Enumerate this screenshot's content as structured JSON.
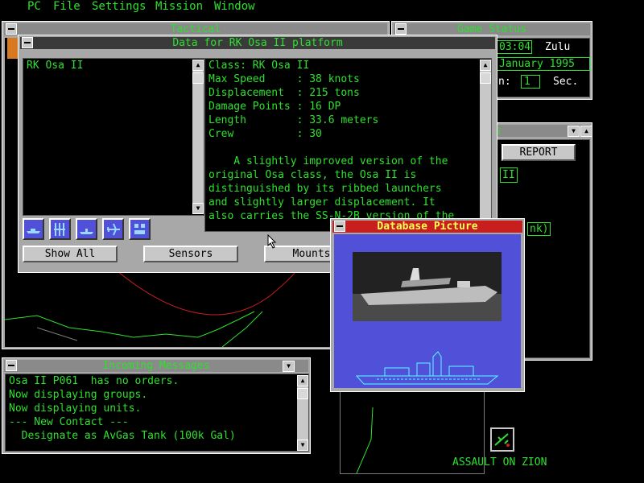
{
  "menu": [
    "PC",
    "File",
    "Settings",
    "Mission",
    "Window"
  ],
  "tactical": {
    "title": "Tactical"
  },
  "game_status": {
    "title": "Game Status",
    "time": "03:04",
    "zone": "Zulu",
    "date": "January 1995",
    "compression_label": "n:",
    "compression_value": "1",
    "unit": "Sec."
  },
  "unit_status": {
    "title": "tus",
    "report_button": "REPORT",
    "line1": "II",
    "line2": "nk)"
  },
  "platform_data": {
    "title": "Data for RK Osa II platform",
    "list_items": [
      "RK Osa II"
    ],
    "details": [
      "Class: RK Osa II",
      "Max Speed     : 38 knots",
      "Displacement  : 215 tons",
      "Damage Points : 16 DP",
      "Length        : 33.6 meters",
      "Crew          : 30"
    ],
    "description": [
      "    A slightly improved version of the",
      "original Osa class, the Osa II is",
      "distinguished by its ribbed launchers",
      "and slightly larger displacement. It",
      "also carries the SS-N-2B version of the"
    ],
    "buttons": {
      "show_all": "Show All",
      "sensors": "Sensors",
      "mounts": "Mounts"
    },
    "icon_buttons": [
      "surface-ship-icon",
      "weapons-icon",
      "submarine-icon",
      "aircraft-icon",
      "facility-icon"
    ]
  },
  "database_picture": {
    "title": "Database Picture"
  },
  "messages": {
    "title": "Incoming Messages",
    "lines": [
      "Osa II P061  has no orders.",
      "Now displaying groups.",
      "Now displaying units.",
      "--- New Contact ---",
      "  Designate as AvGas Tank (100k Gal)"
    ]
  },
  "mission_title": "ASSAULT ON ZION",
  "colors": {
    "text_green": "#2ee02e",
    "window_gray": "#a8a8a8",
    "picture_bg": "#5050d8",
    "picture_title_bg": "#c81e1e",
    "picture_title_fg": "#ffff55"
  }
}
